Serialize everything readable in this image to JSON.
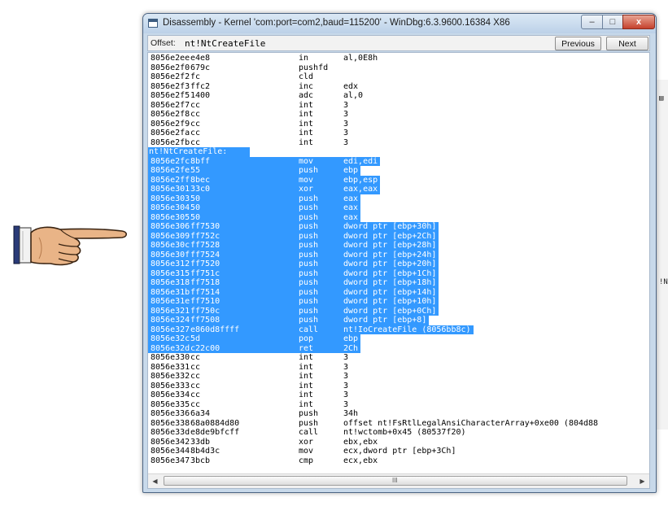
{
  "window": {
    "title": "Disassembly - Kernel 'com:port=com2,baud=115200' - WinDbg:6.3.9600.16384 X86",
    "controls": {
      "minimize": "–",
      "maximize": "□",
      "close": "x"
    }
  },
  "offsetbar": {
    "label": "Offset:",
    "value": "nt!NtCreateFile",
    "prev_label": "Previous",
    "next_label": "Next"
  },
  "background_window": {
    "edge_text": "!N"
  },
  "scrollbar": {
    "left_arrow": "◀",
    "right_arrow": "▶",
    "grip": "III"
  },
  "colors": {
    "selection": "#3399ff",
    "title_bar": "#c8d9ea"
  },
  "listing": [
    {
      "addr": "8056e2ee",
      "bytes": "e4e8",
      "mn": "in",
      "ops": "al,0E8h"
    },
    {
      "addr": "8056e2f0",
      "bytes": "679c",
      "mn": "pushfd",
      "ops": ""
    },
    {
      "addr": "8056e2f2",
      "bytes": "fc",
      "mn": "cld",
      "ops": ""
    },
    {
      "addr": "8056e2f3",
      "bytes": "ffc2",
      "mn": "inc",
      "ops": "edx"
    },
    {
      "addr": "8056e2f5",
      "bytes": "1400",
      "mn": "adc",
      "ops": "al,0"
    },
    {
      "addr": "8056e2f7",
      "bytes": "cc",
      "mn": "int",
      "ops": "3"
    },
    {
      "addr": "8056e2f8",
      "bytes": "cc",
      "mn": "int",
      "ops": "3"
    },
    {
      "addr": "8056e2f9",
      "bytes": "cc",
      "mn": "int",
      "ops": "3"
    },
    {
      "addr": "8056e2fa",
      "bytes": "cc",
      "mn": "int",
      "ops": "3"
    },
    {
      "addr": "8056e2fb",
      "bytes": "cc",
      "mn": "int",
      "ops": "3"
    },
    {
      "label": "nt!NtCreateFile:",
      "sel": true
    },
    {
      "addr": "8056e2fc",
      "bytes": "8bff",
      "mn": "mov",
      "ops": "edi,edi",
      "sel": true
    },
    {
      "addr": "8056e2fe",
      "bytes": "55",
      "mn": "push",
      "ops": "ebp",
      "sel": true
    },
    {
      "addr": "8056e2ff",
      "bytes": "8bec",
      "mn": "mov",
      "ops": "ebp,esp",
      "sel": true
    },
    {
      "addr": "8056e301",
      "bytes": "33c0",
      "mn": "xor",
      "ops": "eax,eax",
      "sel": true
    },
    {
      "addr": "8056e303",
      "bytes": "50",
      "mn": "push",
      "ops": "eax",
      "sel": true
    },
    {
      "addr": "8056e304",
      "bytes": "50",
      "mn": "push",
      "ops": "eax",
      "sel": true
    },
    {
      "addr": "8056e305",
      "bytes": "50",
      "mn": "push",
      "ops": "eax",
      "sel": true
    },
    {
      "addr": "8056e306",
      "bytes": "ff7530",
      "mn": "push",
      "ops": "dword ptr [ebp+30h]",
      "sel": true
    },
    {
      "addr": "8056e309",
      "bytes": "ff752c",
      "mn": "push",
      "ops": "dword ptr [ebp+2Ch]",
      "sel": true
    },
    {
      "addr": "8056e30c",
      "bytes": "ff7528",
      "mn": "push",
      "ops": "dword ptr [ebp+28h]",
      "sel": true
    },
    {
      "addr": "8056e30f",
      "bytes": "ff7524",
      "mn": "push",
      "ops": "dword ptr [ebp+24h]",
      "sel": true
    },
    {
      "addr": "8056e312",
      "bytes": "ff7520",
      "mn": "push",
      "ops": "dword ptr [ebp+20h]",
      "sel": true
    },
    {
      "addr": "8056e315",
      "bytes": "ff751c",
      "mn": "push",
      "ops": "dword ptr [ebp+1Ch]",
      "sel": true
    },
    {
      "addr": "8056e318",
      "bytes": "ff7518",
      "mn": "push",
      "ops": "dword ptr [ebp+18h]",
      "sel": true
    },
    {
      "addr": "8056e31b",
      "bytes": "ff7514",
      "mn": "push",
      "ops": "dword ptr [ebp+14h]",
      "sel": true
    },
    {
      "addr": "8056e31e",
      "bytes": "ff7510",
      "mn": "push",
      "ops": "dword ptr [ebp+10h]",
      "sel": true
    },
    {
      "addr": "8056e321",
      "bytes": "ff750c",
      "mn": "push",
      "ops": "dword ptr [ebp+0Ch]",
      "sel": true
    },
    {
      "addr": "8056e324",
      "bytes": "ff7508",
      "mn": "push",
      "ops": "dword ptr [ebp+8]",
      "sel": true
    },
    {
      "addr": "8056e327",
      "bytes": "e860d8ffff",
      "mn": "call",
      "ops": "nt!IoCreateFile (8056bb8c)",
      "sel": true
    },
    {
      "addr": "8056e32c",
      "bytes": "5d",
      "mn": "pop",
      "ops": "ebp",
      "sel": true
    },
    {
      "addr": "8056e32d",
      "bytes": "c22c00",
      "mn": "ret",
      "ops": "2Ch",
      "sel": true
    },
    {
      "addr": "8056e330",
      "bytes": "cc",
      "mn": "int",
      "ops": "3"
    },
    {
      "addr": "8056e331",
      "bytes": "cc",
      "mn": "int",
      "ops": "3"
    },
    {
      "addr": "8056e332",
      "bytes": "cc",
      "mn": "int",
      "ops": "3"
    },
    {
      "addr": "8056e333",
      "bytes": "cc",
      "mn": "int",
      "ops": "3"
    },
    {
      "addr": "8056e334",
      "bytes": "cc",
      "mn": "int",
      "ops": "3"
    },
    {
      "addr": "8056e335",
      "bytes": "cc",
      "mn": "int",
      "ops": "3"
    },
    {
      "addr": "8056e336",
      "bytes": "6a34",
      "mn": "push",
      "ops": "34h"
    },
    {
      "addr": "8056e338",
      "bytes": "68a0884d80",
      "mn": "push",
      "ops": "offset nt!FsRtlLegalAnsiCharacterArray+0xe00 (804d88"
    },
    {
      "addr": "8056e33d",
      "bytes": "e8de9bfcff",
      "mn": "call",
      "ops": "nt!wctomb+0x45 (80537f20)"
    },
    {
      "addr": "8056e342",
      "bytes": "33db",
      "mn": "xor",
      "ops": "ebx,ebx"
    },
    {
      "addr": "8056e344",
      "bytes": "8b4d3c",
      "mn": "mov",
      "ops": "ecx,dword ptr [ebp+3Ch]"
    },
    {
      "addr": "8056e347",
      "bytes": "3bcb",
      "mn": "cmp",
      "ops": "ecx,ebx"
    }
  ]
}
